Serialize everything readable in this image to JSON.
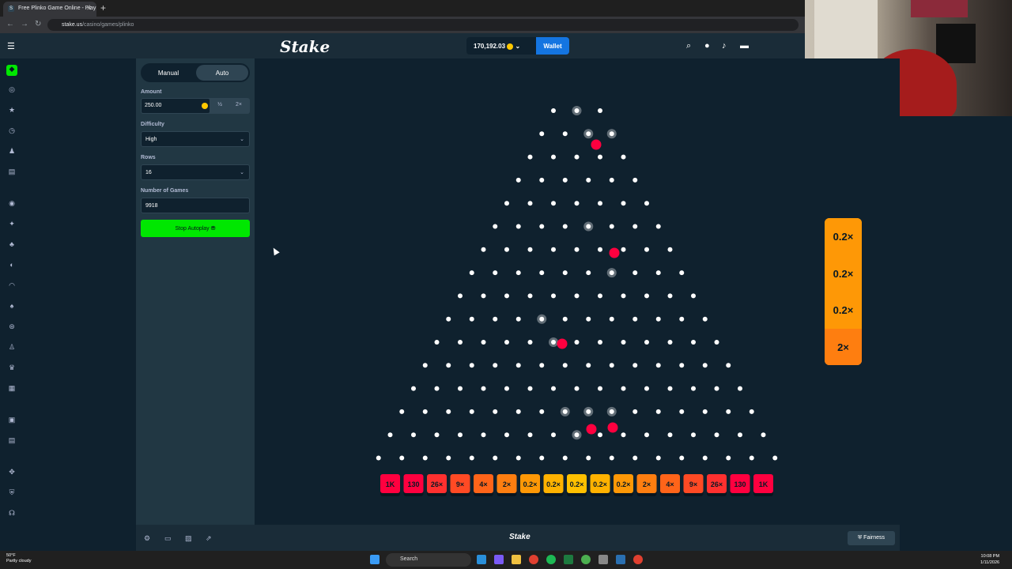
{
  "browser": {
    "tab_title": "Free Plinko Game Online - Play",
    "tab_favicon": "S",
    "url_domain": "stake.us",
    "url_path": "/casino/games/plinko"
  },
  "header": {
    "logo": "Stake",
    "balance": "170,192.03",
    "wallet_label": "Wallet"
  },
  "panel": {
    "mode_manual": "Manual",
    "mode_auto": "Auto",
    "amount_label": "Amount",
    "amount_value": "250.00",
    "half_label": "½",
    "double_label": "2×",
    "difficulty_label": "Difficulty",
    "difficulty_value": "High",
    "rows_label": "Rows",
    "rows_value": "16",
    "games_label": "Number of Games",
    "games_value": "9918",
    "stop_label": "Stop Autoplay"
  },
  "board": {
    "rows": 16,
    "multipliers": [
      "1K",
      "130",
      "26×",
      "9×",
      "4×",
      "2×",
      "0.2×",
      "0.2×",
      "0.2×",
      "0.2×",
      "0.2×",
      "2×",
      "4×",
      "9×",
      "26×",
      "130",
      "1K"
    ],
    "bucket_colors": [
      "#ff003f",
      "#ff003f",
      "#ff302f",
      "#ff4a24",
      "#ff6419",
      "#fe7e10",
      "#fe9806",
      "#ffb200",
      "#ffc000",
      "#ffb200",
      "#fe9806",
      "#fe7e10",
      "#ff6419",
      "#ff4a24",
      "#ff302f",
      "#ff003f",
      "#ff003f"
    ],
    "ball_color": "#ff003f"
  },
  "history": [
    "0.2×",
    "0.2×",
    "0.2×",
    "2×"
  ],
  "footer": {
    "logo": "Stake",
    "fairness_label": "Fairness"
  },
  "taskbar": {
    "temp": "50°F",
    "weather": "Partly cloudy",
    "search": "Search",
    "time": "10:08 PM",
    "date": "1/11/2026"
  }
}
